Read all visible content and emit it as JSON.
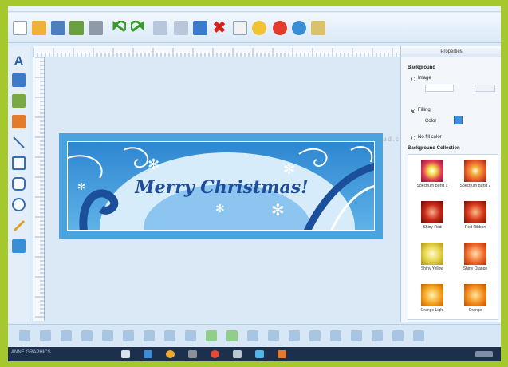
{
  "app": {
    "watermark": "www.SoftwareDownload.com"
  },
  "toolbar": {
    "icons": [
      "new-icon",
      "open-icon",
      "save-icon",
      "save-as-icon",
      "print-icon",
      "undo-icon",
      "redo-icon",
      "cut-icon",
      "copy-icon",
      "paste-icon",
      "delete-icon",
      "zoom-icon",
      "settings-icon",
      "help-icon",
      "web-icon",
      "tool-icon"
    ]
  },
  "banner": {
    "text": "Merry Christmas!",
    "bg_color": "#4aa3dc",
    "accent": "#1f4d9c"
  },
  "properties": {
    "title": "Properties",
    "section": "Background",
    "option_image": "Image",
    "option_filling": "Filling",
    "color_label": "Color",
    "color_value": "#3a8fe0",
    "option_no_fill": "No fill color",
    "collection_label": "Background Collection",
    "items": [
      {
        "name": "Spectrum Burst 1",
        "color": "#e03a55"
      },
      {
        "name": "Spectrum Burst 2",
        "color": "#e85a2c"
      },
      {
        "name": "Shiny Red",
        "color": "#c92818"
      },
      {
        "name": "Red Ribbon",
        "color": "#d83a1c"
      },
      {
        "name": "Shiny Yellow",
        "color": "#e7d54a"
      },
      {
        "name": "Shiny Orange",
        "color": "#f06a2a"
      },
      {
        "name": "Orange Light",
        "color": "#f4a21c"
      },
      {
        "name": "Orange",
        "color": "#f28a18"
      }
    ]
  },
  "taskbar": {
    "start_label": "ANNE GRAPHICS"
  }
}
